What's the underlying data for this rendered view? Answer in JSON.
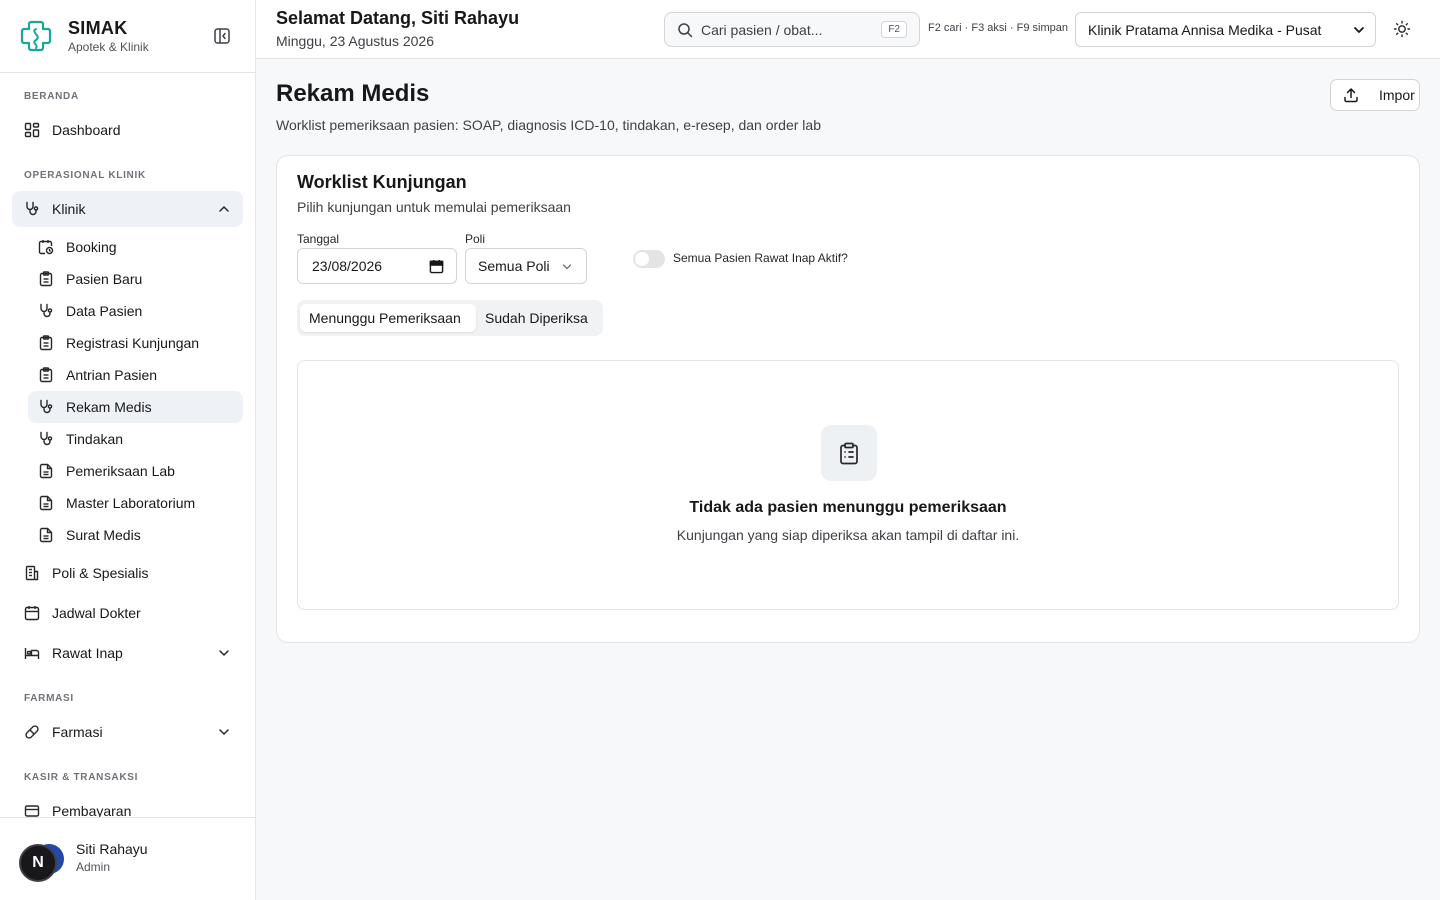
{
  "brand": {
    "name": "SIMAK",
    "subtitle": "Apotek & Klinik"
  },
  "sidebar": {
    "sections": {
      "beranda": "BERANDA",
      "operasional": "OPERASIONAL KLINIK",
      "farmasi": "FARMASI",
      "kasir": "KASIR & TRANSAKSI"
    },
    "items": {
      "dashboard": "Dashboard",
      "klinik": "Klinik",
      "poli": "Poli & Spesialis",
      "jadwal": "Jadwal Dokter",
      "rawat_inap": "Rawat Inap",
      "farmasi": "Farmasi",
      "pembayaran": "Pembayaran"
    },
    "klinik_sub": {
      "booking": "Booking",
      "pasien_baru": "Pasien Baru",
      "data_pasien": "Data Pasien",
      "registrasi": "Registrasi Kunjungan",
      "antrian": "Antrian Pasien",
      "rekam_medis": "Rekam Medis",
      "tindakan": "Tindakan",
      "pemeriksaan_lab": "Pemeriksaan Lab",
      "master_lab": "Master Laboratorium",
      "surat_medis": "Surat Medis"
    },
    "active_item": "Rekam Medis"
  },
  "user": {
    "name": "Siti Rahayu",
    "role": "Admin",
    "badge": "N"
  },
  "header": {
    "greeting": "Selamat Datang, Siti Rahayu",
    "date": "Minggu, 23 Agustus 2026",
    "search_placeholder": "Cari pasien / obat...",
    "search_kbd": "F2",
    "shortcuts": "F2 cari · F3 aksi · F9 simpan",
    "clinic": "Klinik Pratama Annisa Medika - Pusat"
  },
  "page": {
    "title": "Rekam Medis",
    "subtitle": "Worklist pemeriksaan pasien: SOAP, diagnosis ICD-10, tindakan, e-resep, dan order lab",
    "import_label": "Impor"
  },
  "worklist": {
    "title": "Worklist Kunjungan",
    "subtitle": "Pilih kunjungan untuk memulai pemeriksaan",
    "date_label": "Tanggal",
    "date_value": "23/08/2026",
    "poli_label": "Poli",
    "poli_value": "Semua Poli",
    "toggle_label": "Semua Pasien Rawat Inap Aktif?",
    "toggle_on": false,
    "tabs": [
      "Menunggu Pemeriksaan",
      "Sudah Diperiksa"
    ],
    "active_tab": "Menunggu Pemeriksaan",
    "empty_title": "Tidak ada pasien menunggu pemeriksaan",
    "empty_subtitle": "Kunjungan yang siap diperiksa akan tampil di daftar ini."
  },
  "colors": {
    "accent": "#16a99a",
    "active_bg": "#eef2f7",
    "avatar": "#2349a8"
  },
  "icons": {
    "brand": "medical-cross-icon",
    "collapse": "sidebar-collapse-icon",
    "search": "search-icon",
    "theme": "sun-icon",
    "import": "upload-icon",
    "calendar": "calendar-icon",
    "empty": "clipboard-list-icon"
  }
}
